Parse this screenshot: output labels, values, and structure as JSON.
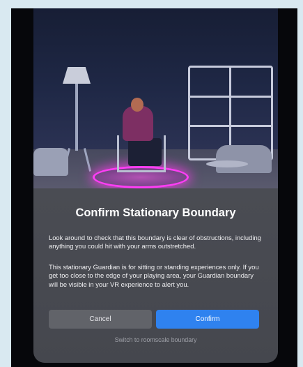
{
  "dialog": {
    "title": "Confirm Stationary Boundary",
    "paragraph_1": "Look around to check that this boundary is clear of obstructions, including anything you could hit with your arms outstretched.",
    "paragraph_2": "This stationary Guardian is for sitting or standing experiences only. If you get too close to the edge of your playing area, your Guardian boundary will be visible in your VR experience to alert you.",
    "cancel_label": "Cancel",
    "confirm_label": "Confirm",
    "switch_label": "Switch to roomscale boundary"
  },
  "colors": {
    "background": "#d9e9f1",
    "frame": "#06070b",
    "dialog": "#4a4c53",
    "confirm_button": "#2f82ef",
    "cancel_button": "#616369",
    "boundary_ring": "#ff3df5"
  },
  "icons": {
    "illustration": "person-sitting-in-stationary-boundary-illustration"
  }
}
